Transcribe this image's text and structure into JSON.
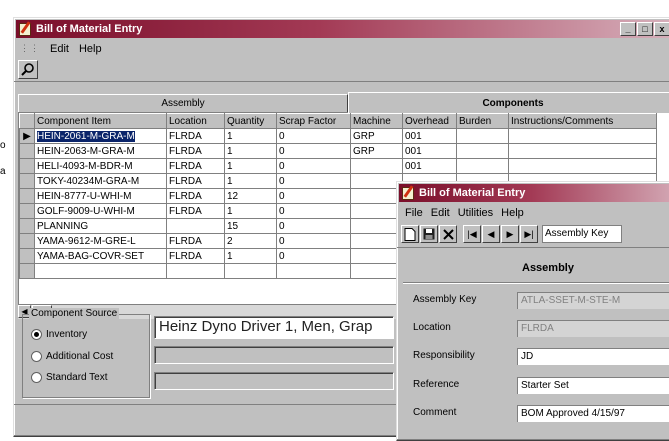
{
  "side_marks": [
    "o",
    "a"
  ],
  "main_window": {
    "title": "Bill of Material Entry",
    "controls": [
      "_",
      "□",
      "x"
    ],
    "menu": [
      "Edit",
      "Help"
    ],
    "tabs": [
      "Assembly",
      "Components"
    ],
    "active_tab": "Components",
    "grid": {
      "columns": [
        "Component Item",
        "Location",
        "Quantity",
        "Scrap Factor",
        "Machine",
        "Overhead",
        "Burden",
        "Instructions/Comments"
      ],
      "rows": [
        [
          "HEIN-2061-M-GRA-M",
          "FLRDA",
          "1",
          "0",
          "GRP",
          "001",
          "",
          ""
        ],
        [
          "HEIN-2063-M-GRA-M",
          "FLRDA",
          "1",
          "0",
          "GRP",
          "001",
          "",
          ""
        ],
        [
          "HELI-4093-M-BDR-M",
          "FLRDA",
          "1",
          "0",
          "",
          "001",
          "",
          ""
        ],
        [
          "TOKY-40234M-GRA-M",
          "FLRDA",
          "1",
          "0",
          "",
          "",
          "",
          ""
        ],
        [
          "HEIN-8777-U-WHI-M",
          "FLRDA",
          "12",
          "0",
          "",
          "",
          "",
          ""
        ],
        [
          "GOLF-9009-U-WHI-M",
          "FLRDA",
          "1",
          "0",
          "",
          "",
          "",
          ""
        ],
        [
          "PLANNING",
          "",
          "15",
          "0",
          "",
          "",
          "",
          ""
        ],
        [
          "YAMA-9612-M-GRE-L",
          "FLRDA",
          "2",
          "0",
          "",
          "",
          "",
          ""
        ],
        [
          "YAMA-BAG-COVR-SET",
          "FLRDA",
          "1",
          "0",
          "",
          "",
          "",
          ""
        ],
        [
          "",
          "",
          "",
          "",
          "",
          "",
          "",
          ""
        ]
      ]
    },
    "component_source": {
      "title": "Component Source",
      "options": [
        "Inventory",
        "Additional Cost",
        "Standard Text"
      ],
      "selected": "Inventory"
    },
    "description": "Heinz Dyno Driver 1, Men, Grap"
  },
  "second_window": {
    "title": "Bill of Material Entry",
    "menu": [
      "File",
      "Edit",
      "Utilities",
      "Help"
    ],
    "combo_value": "Assembly Key",
    "panel_title": "Assembly",
    "fields": [
      {
        "label": "Assembly Key",
        "value": "ATLA-SSET-M-STE-M",
        "dim": true
      },
      {
        "label": "Location",
        "value": "FLRDA",
        "dim": true
      },
      {
        "label": "Responsibility",
        "value": "JD",
        "dim": false
      },
      {
        "label": "Reference",
        "value": "Starter Set",
        "dim": false
      },
      {
        "label": "Comment",
        "value": "BOM Approved 4/15/97",
        "dim": false
      }
    ]
  },
  "icons": [
    "app-icon",
    "search-icon",
    "new-doc-icon",
    "save-icon",
    "delete-icon",
    "first-record-icon",
    "prev-record-icon",
    "next-record-icon",
    "last-record-icon"
  ]
}
